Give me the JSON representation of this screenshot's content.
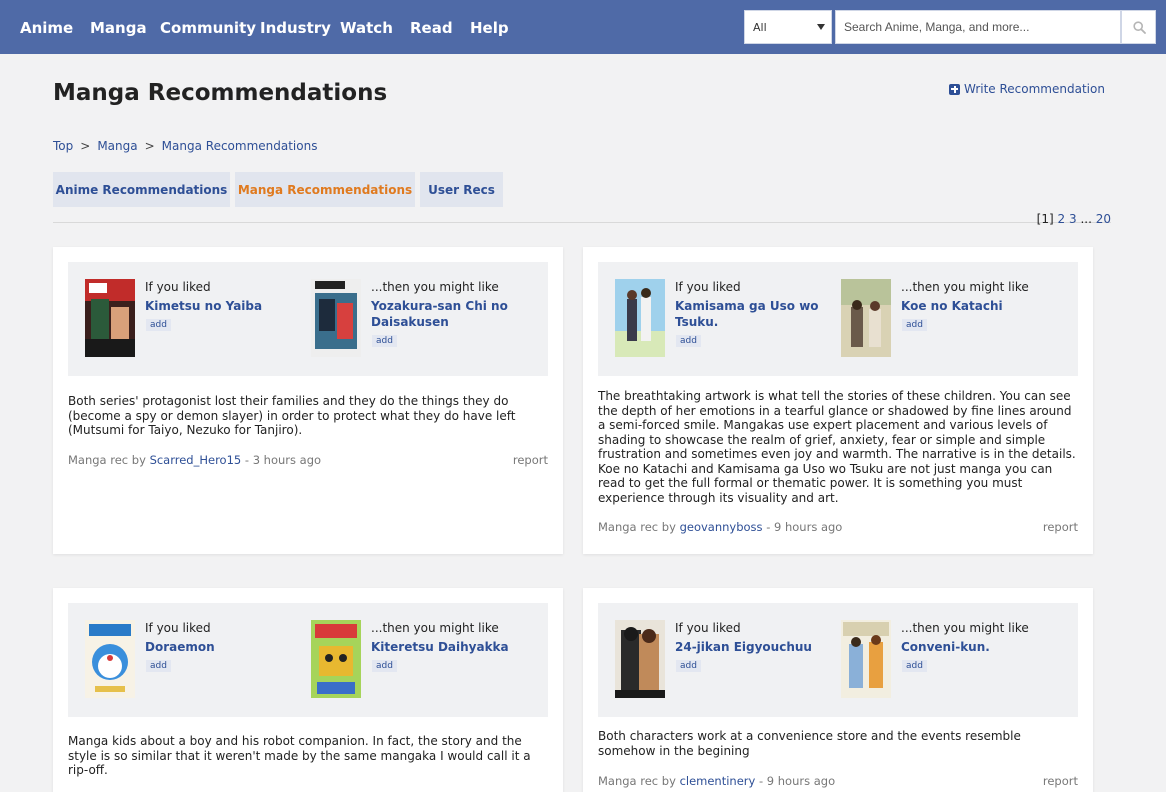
{
  "nav": {
    "items": [
      "Anime",
      "Manga",
      "Community",
      "Industry",
      "Watch",
      "Read",
      "Help"
    ],
    "filter_value": "All",
    "search_placeholder": "Search Anime, Manga, and more..."
  },
  "header": {
    "title": "Manga Recommendations",
    "write_label": "Write Recommendation"
  },
  "breadcrumb": [
    "Top",
    "Manga",
    "Manga Recommendations"
  ],
  "breadcrumb_separator": ">",
  "tabs": [
    {
      "label": "Anime Recommendations",
      "active": false
    },
    {
      "label": "Manga Recommendations",
      "active": true
    },
    {
      "label": "User Recs",
      "active": false
    }
  ],
  "pagination": {
    "current": "[1]",
    "pages": [
      "2",
      "3"
    ],
    "ellipsis": "...",
    "last": "20"
  },
  "labels": {
    "liked": "If you liked",
    "might_like": "...then you might like",
    "add": "add",
    "by": "Manga rec by",
    "dash": "-",
    "report": "report"
  },
  "recs": [
    {
      "liked_title": "Kimetsu no Yaiba",
      "like_title": "Yozakura-san Chi no Daisakusen",
      "text": "Both series' protagonist lost their families and they do the things they do (become a spy or demon slayer) in order to protect what they do have left (Mutsumi for Taiyo, Nezuko for Tanjiro).",
      "user": "Scarred_Hero15",
      "time": "3 hours ago"
    },
    {
      "liked_title": "Kamisama ga Uso wo Tsuku.",
      "like_title": "Koe no Katachi",
      "text": "The breathtaking artwork is what tell the stories of these children. You can see the depth of her emotions in a tearful glance or shadowed by fine lines around a semi-forced smile. Mangakas use expert placement and various levels of shading to showcase the realm of grief, anxiety, fear or simple and simple frustration and sometimes even joy and warmth. The narrative is in the details. Koe no Katachi and Kamisama ga Uso wo Tsuku are not just manga you can read to get the full formal or thematic power. It is something you must experience through its visuality and art.",
      "user": "geovannyboss",
      "time": "9 hours ago"
    },
    {
      "liked_title": "Doraemon",
      "like_title": "Kiteretsu Daihyakka",
      "text": "Manga kids about a boy and his robot companion. In fact, the story and the style is so similar that it weren't made by the same mangaka I would call it a rip-off.",
      "user": "",
      "time": ""
    },
    {
      "liked_title": "24-jikan Eigyouchuu",
      "like_title": "Conveni-kun.",
      "text": "Both characters work at a convenience store and the events resemble somehow in the begining",
      "user": "clementinery",
      "time": "9 hours ago"
    }
  ],
  "colors": {
    "nav_bg": "#4f6aa7",
    "link": "#2e4f96",
    "active_tab": "#e07a1f",
    "page_bg": "#f2f2f3"
  }
}
